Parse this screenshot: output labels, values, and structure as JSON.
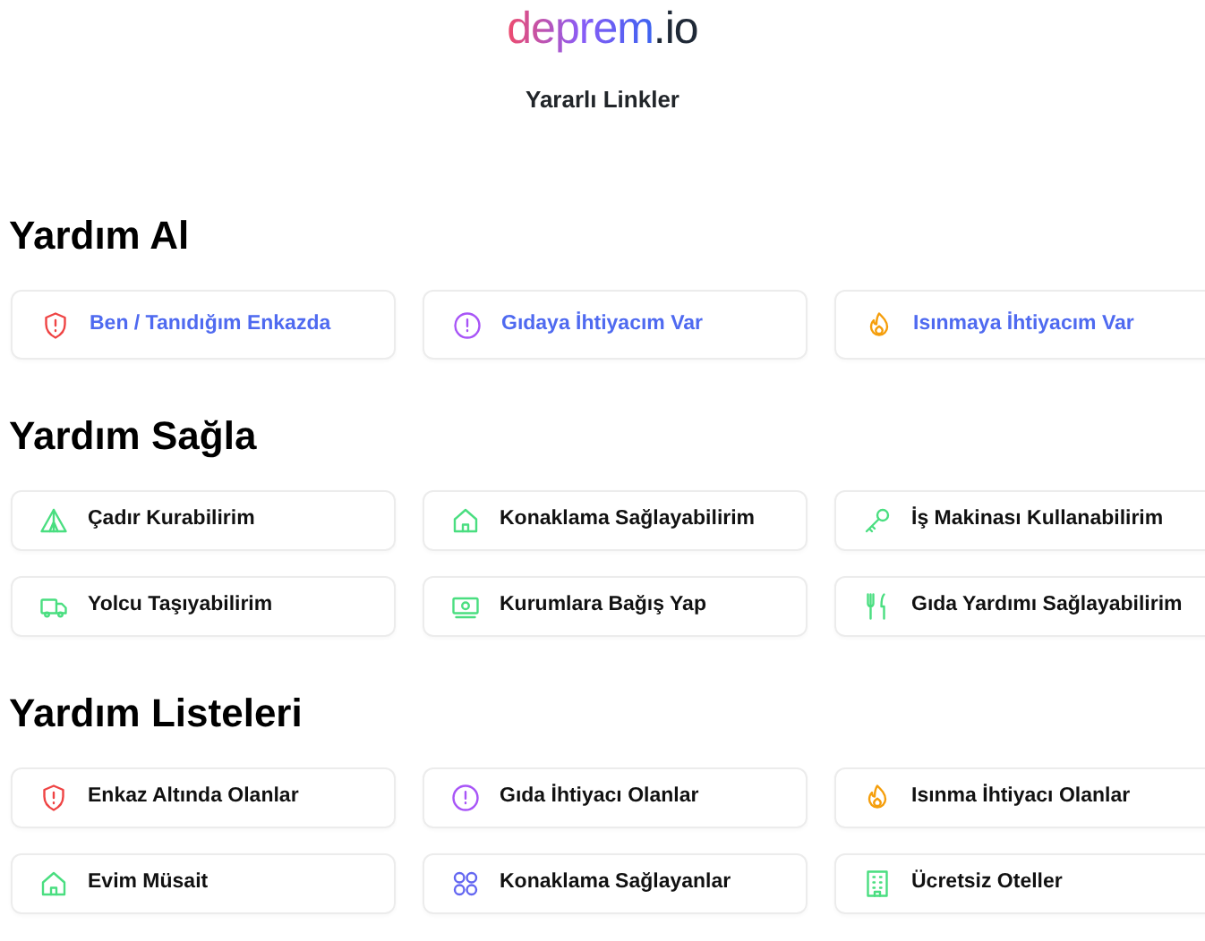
{
  "logo": {
    "main": "deprem",
    "suffix": ".io"
  },
  "subtitle": "Yararlı Linkler",
  "sections": [
    {
      "title": "Yardım Al",
      "kind": "urgent",
      "links": [
        {
          "label": "Ben / Tanıdığım Enkazda",
          "color": "#ef4444"
        },
        {
          "label": "Gıdaya İhtiyacım Var",
          "color": "#a855f7"
        },
        {
          "label": "Isınmaya İhtiyacım Var",
          "color": "#f59e0b"
        }
      ]
    },
    {
      "title": "Yardım Sağla",
      "kind": "normal",
      "links": [
        {
          "label": "Çadır Kurabilirim",
          "color": "#4ade80"
        },
        {
          "label": "Konaklama Sağlayabilirim",
          "color": "#4ade80"
        },
        {
          "label": "İş Makinası Kullanabilirim",
          "color": "#4ade80"
        },
        {
          "label": "Yolcu Taşıyabilirim",
          "color": "#4ade80"
        },
        {
          "label": "Kurumlara Bağış Yap",
          "color": "#4ade80"
        },
        {
          "label": "Gıda Yardımı Sağlayabilirim",
          "color": "#4ade80"
        }
      ]
    },
    {
      "title": "Yardım Listeleri",
      "kind": "normal",
      "links": [
        {
          "label": "Enkaz Altında Olanlar",
          "color": "#ef4444"
        },
        {
          "label": "Gıda İhtiyacı Olanlar",
          "color": "#a855f7"
        },
        {
          "label": "Isınma İhtiyacı Olanlar",
          "color": "#f59e0b"
        },
        {
          "label": "Evim Müsait",
          "color": "#4ade80"
        },
        {
          "label": "Konaklama Sağlayanlar",
          "color": "#6366f1"
        },
        {
          "label": "Ücretsiz Oteller",
          "color": "#4ade80"
        }
      ]
    }
  ]
}
